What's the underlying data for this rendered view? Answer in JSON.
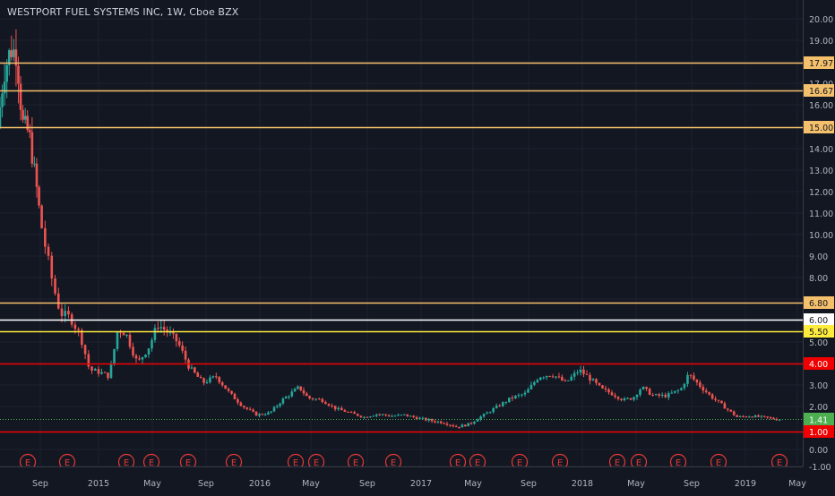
{
  "header": {
    "title": "WESTPORT FUEL SYSTEMS INC, 1W, Cboe BZX"
  },
  "colors": {
    "background": "#131722",
    "grid": "#1e2230",
    "text": "#b2b5be",
    "up": "#26a69a",
    "down": "#ef5350",
    "line_orange": "#f5c06b",
    "line_white": "#ffffff",
    "line_yellow": "#ffeb3b",
    "line_red": "#f00000",
    "last_price": "#4caf50",
    "earnings": "#e53935"
  },
  "chart_data": {
    "type": "candlestick",
    "title": "WESTPORT FUEL SYSTEMS INC, 1W, Cboe BZX",
    "interval": "1W",
    "y_scale": "log",
    "y_axis_ticks": [
      "20.00",
      "19.00",
      "18.00",
      "17.00",
      "16.00",
      "15.00",
      "14.00",
      "13.00",
      "12.00",
      "11.00",
      "10.00",
      "9.00",
      "8.00",
      "7.00",
      "6.00",
      "5.00",
      "4.00",
      "3.00",
      "2.00",
      "1.00",
      "0.00",
      "-1.00"
    ],
    "x_axis_ticks": [
      "Sep",
      "2015",
      "May",
      "Sep",
      "2016",
      "May",
      "Sep",
      "2017",
      "May",
      "Sep",
      "2018",
      "May",
      "Sep",
      "2019",
      "May"
    ],
    "horizontal_lines": [
      {
        "value": 17.97,
        "label": "17.97",
        "color": "orange"
      },
      {
        "value": 16.67,
        "label": "16.67",
        "color": "orange"
      },
      {
        "value": 15.0,
        "label": "15.00",
        "color": "orange"
      },
      {
        "value": 6.8,
        "label": "6.80",
        "color": "orange"
      },
      {
        "value": 6.0,
        "label": "6.00",
        "color": "white"
      },
      {
        "value": 5.5,
        "label": "5.50",
        "color": "yellow"
      },
      {
        "value": 4.0,
        "label": "4.00",
        "color": "red"
      },
      {
        "value": 1.0,
        "label": "1.00",
        "color": "red"
      }
    ],
    "last_price": {
      "value": 1.41,
      "label": "1.41"
    },
    "earnings_marker": "E",
    "earnings_markers": [
      "2014-06",
      "2014-08",
      "2014-11",
      "2015-02",
      "2015-05",
      "2015-08",
      "2015-11",
      "2016-02",
      "2016-03",
      "2016-05",
      "2016-08",
      "2017-02",
      "2017-03",
      "2017-05",
      "2017-08",
      "2017-11",
      "2018-02",
      "2018-03",
      "2018-05",
      "2018-08",
      "2018-11",
      "2019-03"
    ],
    "price_path": [
      [
        "2014-05-01",
        15.0
      ],
      [
        "2014-05-20",
        17.5
      ],
      [
        "2014-06-10",
        18.6
      ],
      [
        "2014-06-28",
        18.4
      ],
      [
        "2014-07-15",
        15.2
      ],
      [
        "2014-08-05",
        14.7
      ],
      [
        "2014-08-25",
        12.5
      ],
      [
        "2014-09-15",
        9.8
      ],
      [
        "2014-10-05",
        7.6
      ],
      [
        "2014-10-20",
        6.3
      ],
      [
        "2014-11-10",
        6.1
      ],
      [
        "2014-12-01",
        5.3
      ],
      [
        "2014-12-20",
        3.7
      ],
      [
        "2015-01-10",
        3.6
      ],
      [
        "2015-02-01",
        3.4
      ],
      [
        "2015-02-20",
        5.6
      ],
      [
        "2015-03-10",
        5.4
      ],
      [
        "2015-04-05",
        4.0
      ],
      [
        "2015-05-01",
        4.8
      ],
      [
        "2015-05-20",
        5.8
      ],
      [
        "2015-06-10",
        5.5
      ],
      [
        "2015-07-05",
        5.0
      ],
      [
        "2015-08-01",
        3.8
      ],
      [
        "2015-09-01",
        3.1
      ],
      [
        "2015-10-01",
        3.4
      ],
      [
        "2015-11-01",
        2.6
      ],
      [
        "2015-12-01",
        2.0
      ],
      [
        "2016-01-01",
        1.6
      ],
      [
        "2016-02-01",
        1.7
      ],
      [
        "2016-03-01",
        2.3
      ],
      [
        "2016-04-10",
        2.9
      ],
      [
        "2016-05-01",
        2.4
      ],
      [
        "2016-06-01",
        2.3
      ],
      [
        "2016-07-01",
        1.9
      ],
      [
        "2016-08-01",
        1.7
      ],
      [
        "2016-09-01",
        1.5
      ],
      [
        "2016-10-01",
        1.65
      ],
      [
        "2016-11-01",
        1.55
      ],
      [
        "2016-12-01",
        1.6
      ],
      [
        "2017-01-01",
        1.45
      ],
      [
        "2017-02-01",
        1.35
      ],
      [
        "2017-03-01",
        1.3
      ],
      [
        "2017-04-01",
        1.15
      ],
      [
        "2017-05-01",
        1.25
      ],
      [
        "2017-06-01",
        1.6
      ],
      [
        "2017-07-01",
        2.0
      ],
      [
        "2017-08-01",
        2.4
      ],
      [
        "2017-09-01",
        2.6
      ],
      [
        "2017-10-01",
        3.4
      ],
      [
        "2017-11-01",
        3.5
      ],
      [
        "2017-12-01",
        3.1
      ],
      [
        "2018-01-01",
        3.7
      ],
      [
        "2018-01-25",
        3.3
      ],
      [
        "2018-02-20",
        2.8
      ],
      [
        "2018-03-15",
        2.6
      ],
      [
        "2018-04-10",
        2.3
      ],
      [
        "2018-05-01",
        2.4
      ],
      [
        "2018-05-20",
        2.9
      ],
      [
        "2018-06-15",
        2.5
      ],
      [
        "2018-07-15",
        2.5
      ],
      [
        "2018-08-15",
        2.8
      ],
      [
        "2018-09-01",
        3.5
      ],
      [
        "2018-09-25",
        3.0
      ],
      [
        "2018-10-20",
        2.5
      ],
      [
        "2018-11-20",
        2.0
      ],
      [
        "2018-12-20",
        1.5
      ],
      [
        "2019-01-20",
        1.55
      ],
      [
        "2019-02-15",
        1.5
      ],
      [
        "2019-03-20",
        1.41
      ]
    ]
  }
}
